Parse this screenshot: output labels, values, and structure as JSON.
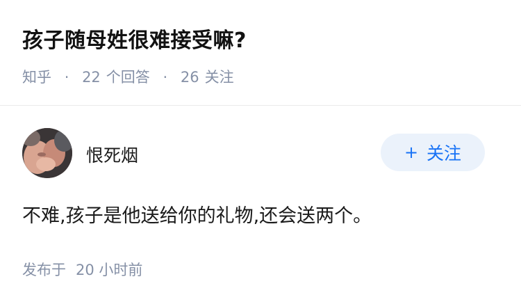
{
  "question": {
    "title": "孩子随母姓很难接受嘛?",
    "source": "知乎",
    "answer_count": "22",
    "answer_label": "个回答",
    "follower_count": "26",
    "follower_label": "关注"
  },
  "answer": {
    "author_name": "恨死烟",
    "follow_button_label": "关注",
    "follow_button_icon": "plus-icon",
    "content": "不难,孩子是他送给你的礼物,还会送两个。",
    "published_label": "发布于",
    "published_time": "20 小时前"
  },
  "colors": {
    "meta_text": "#8590a6",
    "accent": "#1772f6",
    "follow_bg": "#ebf2fb",
    "divider": "#ebebeb"
  }
}
